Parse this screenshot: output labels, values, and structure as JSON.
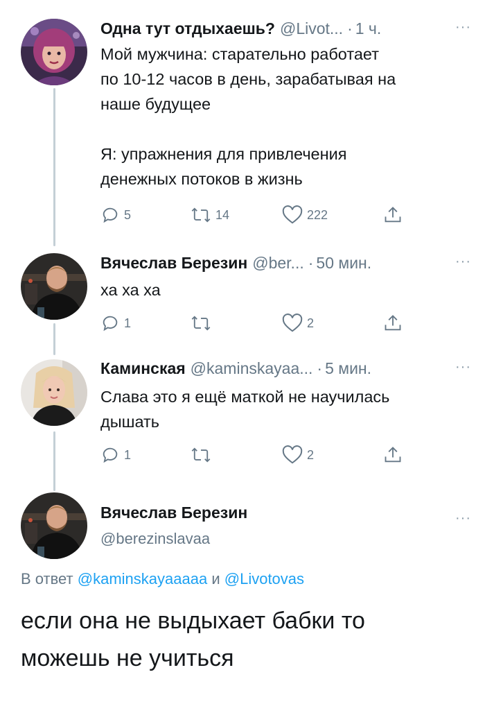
{
  "thread": [
    {
      "author_name": "Одна тут отдыхаешь?",
      "author_handle": "@Livot...",
      "time": "1 ч.",
      "more_icon": "···",
      "text_lines": [
        "Мой мужчина: старательно работает",
        "по 10-12 часов в день, зарабатывая на",
        "наше будущее",
        "",
        "Я: упражнения для привлечения",
        "денежных потоков в жизнь"
      ],
      "reply_count": "5",
      "retweet_count": "14",
      "like_count": "222"
    },
    {
      "author_name": "Вячеслав Березин",
      "author_handle": "@ber...",
      "time": "50 мин.",
      "more_icon": "···",
      "text_lines": [
        "ха ха ха"
      ],
      "reply_count": "1",
      "retweet_count": "",
      "like_count": "2"
    },
    {
      "author_name": "Каминская",
      "author_handle": "@kaminskayaa...",
      "time": "5 мин.",
      "more_icon": "···",
      "text_lines": [
        "Слава это я ещё маткой не научилась",
        "дышать"
      ],
      "reply_count": "1",
      "retweet_count": "",
      "like_count": "2"
    }
  ],
  "main_tweet": {
    "author_name": "Вячеслав Березин",
    "author_handle": "@berezinslavaa",
    "more_icon": "···",
    "reply_prefix": "В ответ",
    "reply_user_1": "@kaminskayaaaaa",
    "reply_conj": "и",
    "reply_user_2": "@Livotovas",
    "text_lines": [
      "если она не выдыхает бабки то",
      "можешь не учиться"
    ]
  },
  "colors": {
    "accent": "#1da1f2",
    "secondary_text": "#657786",
    "thread_line": "#c4cfd6",
    "primary_text": "#14171a"
  },
  "icons": {
    "reply": "reply-icon",
    "retweet": "retweet-icon",
    "like": "heart-icon",
    "share": "share-icon",
    "more": "more-icon"
  }
}
